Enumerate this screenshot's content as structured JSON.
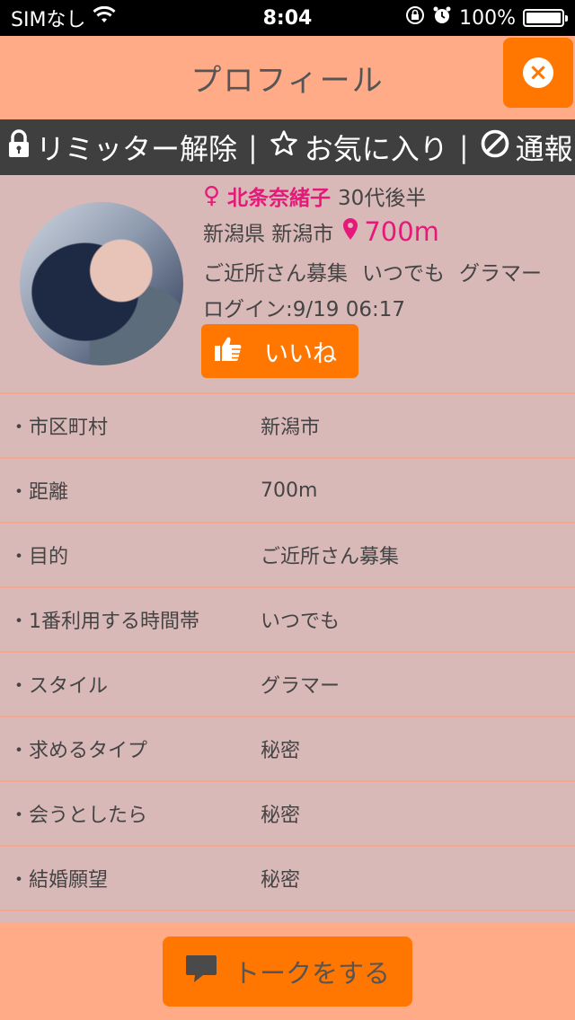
{
  "status_bar": {
    "carrier": "SIMなし",
    "time": "8:04",
    "battery_text": "100%",
    "battery_level": 1.0
  },
  "header": {
    "title": "プロフィール"
  },
  "actions": {
    "limiter": "リミッター解除",
    "favorite": "お気に入り",
    "report": "通報"
  },
  "profile": {
    "gender_symbol": "♀",
    "name": "北条奈緒子",
    "age": "30代後半",
    "location": "新潟県 新潟市",
    "distance": "700m",
    "tags": [
      "ご近所さん募集",
      "いつでも",
      "グラマー"
    ],
    "login": "ログイン:9/19 06:17",
    "like_label": "いいね"
  },
  "details": [
    {
      "label": "市区町村",
      "value": "新潟市"
    },
    {
      "label": "距離",
      "value": "700m"
    },
    {
      "label": "目的",
      "value": "ご近所さん募集"
    },
    {
      "label": "1番利用する時間帯",
      "value": "いつでも"
    },
    {
      "label": "スタイル",
      "value": "グラマー"
    },
    {
      "label": "求めるタイプ",
      "value": "秘密"
    },
    {
      "label": "会うとしたら",
      "value": "秘密"
    },
    {
      "label": "結婚願望",
      "value": "秘密"
    }
  ],
  "bottom": {
    "talk_label": "トークをする"
  },
  "colors": {
    "accent": "#ff7700",
    "header_bg": "#ffab88",
    "body_bg": "#d9b8b8",
    "pink": "#e6197a"
  }
}
